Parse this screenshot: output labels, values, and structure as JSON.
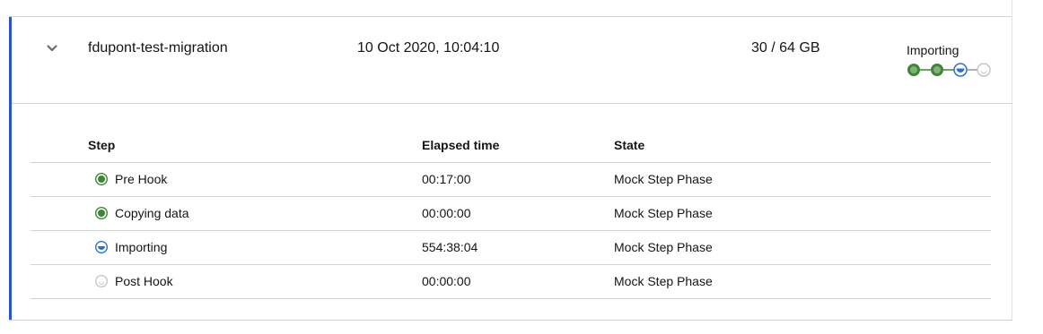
{
  "plan": {
    "name": "fdupont-test-migration",
    "started": "10 Oct 2020, 10:04:10",
    "size": "30 / 64 GB",
    "status": "Importing",
    "progress_steps": [
      "complete",
      "complete",
      "in-progress",
      "pending"
    ]
  },
  "steps_table": {
    "headers": {
      "step": "Step",
      "elapsed": "Elapsed time",
      "state": "State"
    },
    "rows": [
      {
        "name": "Pre Hook",
        "elapsed": "00:17:00",
        "state": "Mock Step Phase",
        "status": "complete"
      },
      {
        "name": "Copying data",
        "elapsed": "00:00:00",
        "state": "Mock Step Phase",
        "status": "complete"
      },
      {
        "name": "Importing",
        "elapsed": "554:38:04",
        "state": "Mock Step Phase",
        "status": "in-progress"
      },
      {
        "name": "Post Hook",
        "elapsed": "00:00:00",
        "state": "Mock Step Phase",
        "status": "pending"
      }
    ]
  },
  "colors": {
    "accent": "#2b52d4",
    "complete": "#3e8635",
    "in_progress": "#2b6fd6",
    "pending": "#c7c7c7"
  },
  "icons": {
    "toggle": "chevron-down-icon",
    "complete": "check-circle-icon",
    "in_progress": "half-circle-icon",
    "pending": "empty-circle-icon"
  }
}
